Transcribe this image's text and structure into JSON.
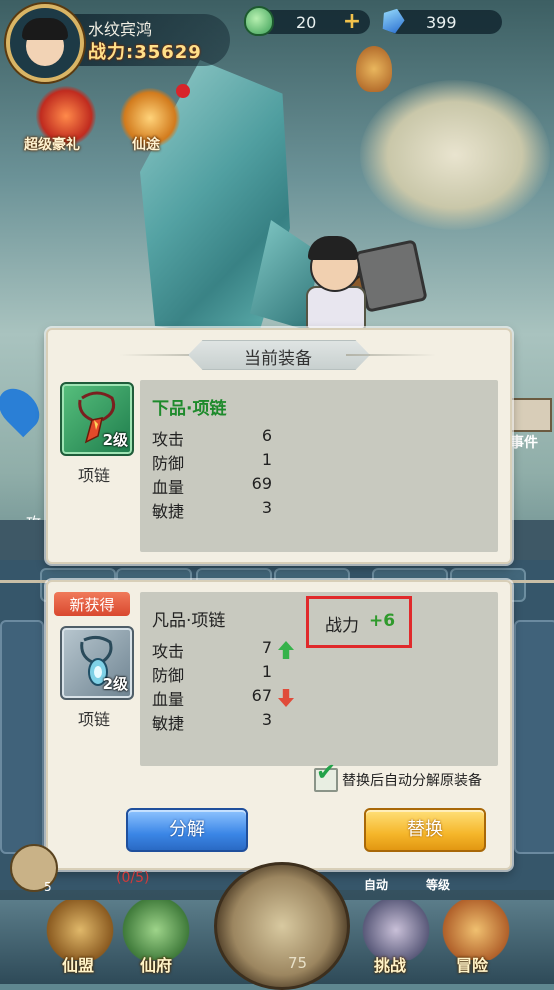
{
  "hud": {
    "player_name": "水纹宾鸿",
    "power_text": "战力:35629",
    "jade": "20",
    "gems": "399"
  },
  "side_buttons": {
    "super_gift": "超级豪礼",
    "xian_tu": "仙途"
  },
  "current_equipment": {
    "title": "当前装备",
    "level": "2级",
    "item_name": "项链",
    "quality": "下品·项链",
    "stats": [
      {
        "label": "攻击",
        "value": "6"
      },
      {
        "label": "防御",
        "value": "1"
      },
      {
        "label": "血量",
        "value": "69"
      },
      {
        "label": "敏捷",
        "value": "3"
      }
    ]
  },
  "new_equipment": {
    "badge": "新获得",
    "level": "2级",
    "item_name": "项链",
    "quality": "凡品·项链",
    "power_label": "战力",
    "power_delta": "+6",
    "stats": [
      {
        "label": "攻击",
        "value": "7",
        "trend": "up"
      },
      {
        "label": "防御",
        "value": "1",
        "trend": "none"
      },
      {
        "label": "血量",
        "value": "67",
        "trend": "down"
      },
      {
        "label": "敏捷",
        "value": "3",
        "trend": "none"
      }
    ],
    "auto_decompose_label": "替换后自动分解原装备",
    "auto_decompose_checked": true,
    "decompose_button": "分解",
    "replace_button": "替换"
  },
  "bottom_nav": {
    "items": [
      "仙盟",
      "仙府",
      "挑战",
      "冒险"
    ],
    "center_value": "75",
    "level_badge": "5",
    "progress": "(0/5)",
    "auto": "自动",
    "grade": "等级"
  },
  "partial_labels": {
    "left": "攻",
    "right": "事件"
  },
  "colors": {
    "green_quality": "#1e8a2c",
    "power_delta": "#2f9a2c",
    "highlight_border": "#e0292b",
    "up_arrow": "#36b24a",
    "down_arrow": "#e04b3a"
  }
}
